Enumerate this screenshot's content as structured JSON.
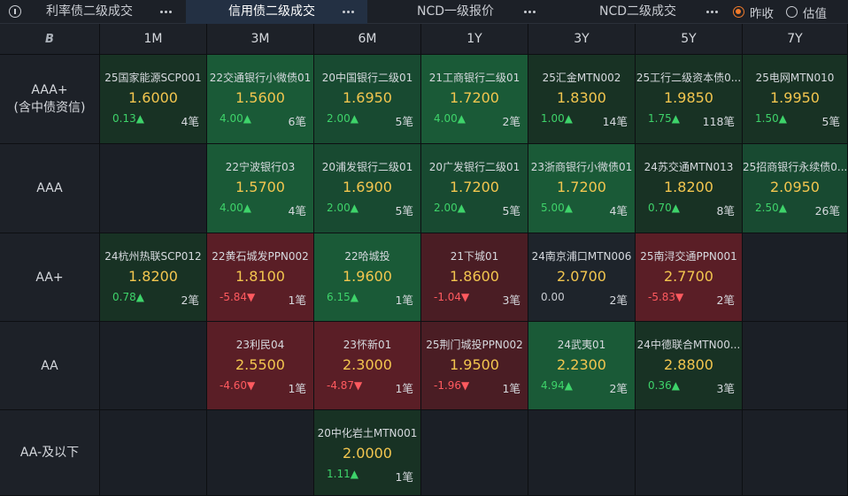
{
  "tabs": [
    {
      "label": "利率债二级成交",
      "active": false
    },
    {
      "label": "信用债二级成交",
      "active": true
    },
    {
      "label": "NCD一级报价",
      "active": false
    },
    {
      "label": "NCD二级成交",
      "active": false
    }
  ],
  "radio": [
    {
      "label": "昨收",
      "selected": true
    },
    {
      "label": "估值",
      "selected": false
    }
  ],
  "corner_label": "B",
  "columns": [
    "1M",
    "3M",
    "6M",
    "1Y",
    "3Y",
    "5Y",
    "7Y"
  ],
  "rows": [
    {
      "label": [
        "AAA+",
        "(含中债资信)"
      ],
      "cells": [
        {
          "name": "25国家能源SCP001",
          "rate": "1.6000",
          "chg": "0.13▲",
          "dir": "up",
          "count": "4笔",
          "tone": "g-dark"
        },
        {
          "name": "22交通银行小微债01",
          "rate": "1.5600",
          "chg": "4.00▲",
          "dir": "up",
          "count": "6笔",
          "tone": "g-bright"
        },
        {
          "name": "20中国银行二级01",
          "rate": "1.6950",
          "chg": "2.00▲",
          "dir": "up",
          "count": "5笔",
          "tone": "g-mid"
        },
        {
          "name": "21工商银行二级01",
          "rate": "1.7200",
          "chg": "4.00▲",
          "dir": "up",
          "count": "2笔",
          "tone": "g-bright"
        },
        {
          "name": "25汇金MTN002",
          "rate": "1.8300",
          "chg": "1.00▲",
          "dir": "up",
          "count": "14笔",
          "tone": "g-dark"
        },
        {
          "name": "25工行二级资本债0...",
          "rate": "1.9850",
          "chg": "1.75▲",
          "dir": "up",
          "count": "118笔",
          "tone": "g-dark"
        },
        {
          "name": "25电网MTN010",
          "rate": "1.9950",
          "chg": "1.50▲",
          "dir": "up",
          "count": "5笔",
          "tone": "g-dark"
        }
      ]
    },
    {
      "label": [
        "AAA"
      ],
      "cells": [
        null,
        {
          "name": "22宁波银行03",
          "rate": "1.5700",
          "chg": "4.00▲",
          "dir": "up",
          "count": "4笔",
          "tone": "g-bright"
        },
        {
          "name": "20浦发银行二级01",
          "rate": "1.6900",
          "chg": "2.00▲",
          "dir": "up",
          "count": "5笔",
          "tone": "g-mid"
        },
        {
          "name": "20广发银行二级01",
          "rate": "1.7200",
          "chg": "2.00▲",
          "dir": "up",
          "count": "5笔",
          "tone": "g-mid"
        },
        {
          "name": "23浙商银行小微债01",
          "rate": "1.7200",
          "chg": "5.00▲",
          "dir": "up",
          "count": "4笔",
          "tone": "g-bright"
        },
        {
          "name": "24苏交通MTN013",
          "rate": "1.8200",
          "chg": "0.70▲",
          "dir": "up",
          "count": "8笔",
          "tone": "g-dark"
        },
        {
          "name": "25招商银行永续债0...",
          "rate": "2.0950",
          "chg": "2.50▲",
          "dir": "up",
          "count": "26笔",
          "tone": "g-mid"
        }
      ]
    },
    {
      "label": [
        "AA+"
      ],
      "cells": [
        {
          "name": "24杭州热联SCP012",
          "rate": "1.8200",
          "chg": "0.78▲",
          "dir": "up",
          "count": "2笔",
          "tone": "g-dark"
        },
        {
          "name": "22黄石城发PPN002",
          "rate": "1.8100",
          "chg": "-5.84▼",
          "dir": "down",
          "count": "1笔",
          "tone": "r-bright"
        },
        {
          "name": "22哈城投",
          "rate": "1.9600",
          "chg": "6.15▲",
          "dir": "up",
          "count": "1笔",
          "tone": "g-bright"
        },
        {
          "name": "21下城01",
          "rate": "1.8600",
          "chg": "-1.04▼",
          "dir": "down",
          "count": "3笔",
          "tone": "r-mid"
        },
        {
          "name": "24南京浦口MTN006",
          "rate": "2.0700",
          "chg": "0.00",
          "dir": "flat",
          "count": "2笔",
          "tone": "neutral"
        },
        {
          "name": "25南浔交通PPN001",
          "rate": "2.7700",
          "chg": "-5.83▼",
          "dir": "down",
          "count": "2笔",
          "tone": "r-bright"
        },
        null
      ]
    },
    {
      "label": [
        "AA"
      ],
      "cells": [
        null,
        {
          "name": "23利民04",
          "rate": "2.5500",
          "chg": "-4.60▼",
          "dir": "down",
          "count": "1笔",
          "tone": "r-bright"
        },
        {
          "name": "23怀新01",
          "rate": "2.3000",
          "chg": "-4.87▼",
          "dir": "down",
          "count": "1笔",
          "tone": "r-bright"
        },
        {
          "name": "25荆门城投PPN002",
          "rate": "1.9500",
          "chg": "-1.96▼",
          "dir": "down",
          "count": "1笔",
          "tone": "r-mid"
        },
        {
          "name": "24武夷01",
          "rate": "2.2300",
          "chg": "4.94▲",
          "dir": "up",
          "count": "2笔",
          "tone": "g-bright"
        },
        {
          "name": "24中德联合MTN00...",
          "rate": "2.8800",
          "chg": "0.36▲",
          "dir": "up",
          "count": "3笔",
          "tone": "g-dark"
        },
        null
      ]
    },
    {
      "label": [
        "AA-及以下"
      ],
      "cells": [
        null,
        null,
        {
          "name": "20中化岩土MTN001",
          "rate": "2.0000",
          "chg": "1.11▲",
          "dir": "up",
          "count": "1笔",
          "tone": "g-dark"
        },
        null,
        null,
        null,
        null
      ]
    }
  ]
}
